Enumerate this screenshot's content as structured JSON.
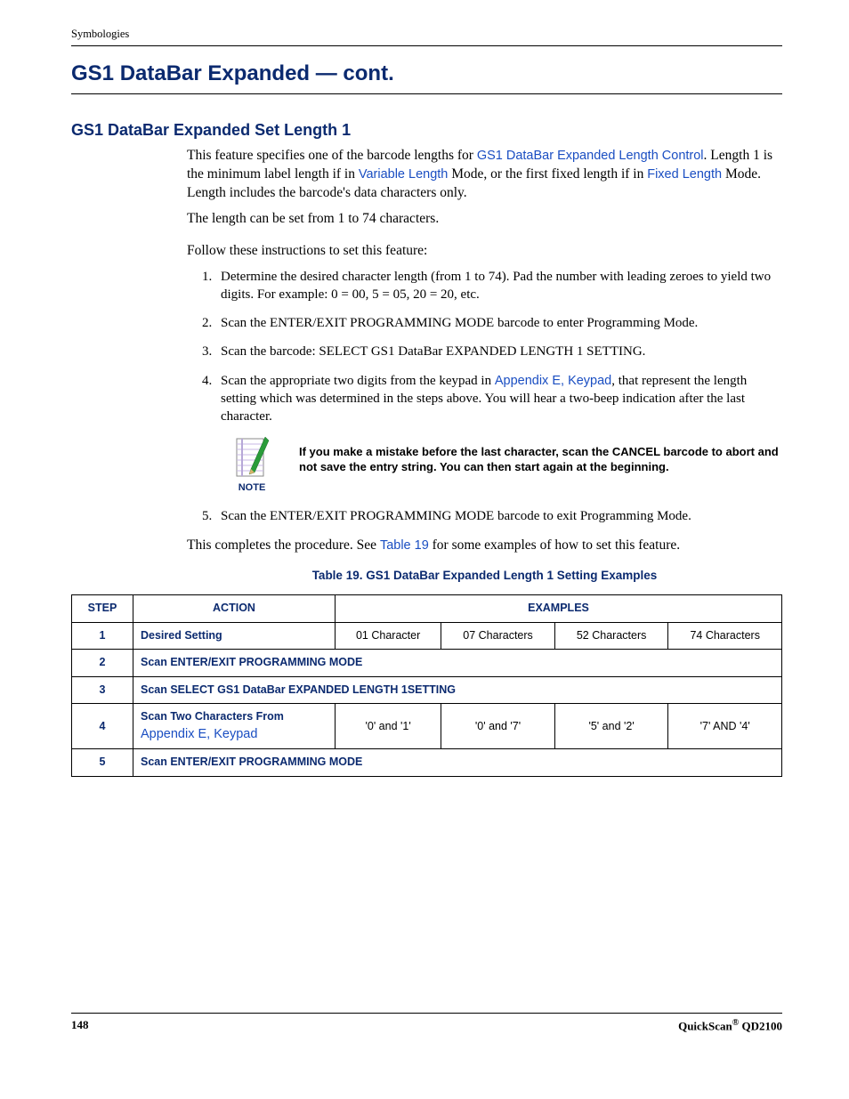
{
  "header": {
    "section": "Symbologies"
  },
  "headings": {
    "main": "GS1 DataBar Expanded — cont.",
    "sub": "GS1 DataBar Expanded Set Length 1"
  },
  "body": {
    "p1a": "This feature specifies one of the barcode lengths for ",
    "link_length_control": "GS1 DataBar Expanded Length Control",
    "p1b": ". Length 1 is the minimum label length if in ",
    "link_variable": "Variable Length",
    "p1c": " Mode, or the first fixed length if in ",
    "link_fixed": "Fixed Length",
    "p1d": " Mode. Length includes the barcode's data characters only.",
    "p2": "The length can be set from 1 to 74 characters.",
    "p3": "Follow these instructions to set this feature:"
  },
  "steps": {
    "s1": "Determine the desired character length (from 1 to 74). Pad the number with leading zeroes to yield two digits. For example: 0 = 00, 5 = 05, 20 = 20, etc.",
    "s2": "Scan the ENTER/EXIT PROGRAMMING MODE barcode to enter Programming Mode.",
    "s3": "Scan the barcode: SELECT GS1 DataBar EXPANDED LENGTH 1 SETTING.",
    "s4a": "Scan the appropriate two digits from the keypad in ",
    "s4_link": "Appendix E, Keypad",
    "s4b": ", that represent the length setting which was determined in the steps above. You will hear a two-beep indication after the last character.",
    "s5": "Scan the ENTER/EXIT PROGRAMMING MODE barcode to exit Programming Mode."
  },
  "note": {
    "label": "NOTE",
    "text": "If you make a mistake before the last character, scan the CANCEL barcode to abort and not save the entry string. You can then start again at the beginning."
  },
  "closing": {
    "a": "This completes the procedure. See ",
    "link": "Table 19",
    "b": " for some examples of how to set this feature."
  },
  "table": {
    "caption": "Table 19. GS1 DataBar Expanded Length 1 Setting Examples",
    "headers": {
      "step": "STEP",
      "action": "ACTION",
      "examples": "EXAMPLES"
    },
    "rows": {
      "r1": {
        "step": "1",
        "action": "Desired Setting",
        "c1": "01 Character",
        "c2": "07 Characters",
        "c3": "52 Characters",
        "c4": "74 Characters"
      },
      "r2": {
        "step": "2",
        "action": "Scan ENTER/EXIT PROGRAMMING MODE"
      },
      "r3": {
        "step": "3",
        "action": "Scan SELECT GS1 DataBar EXPANDED LENGTH 1SETTING"
      },
      "r4": {
        "step": "4",
        "action_a": "Scan Two Characters From ",
        "action_link": "Appendix E, Keypad",
        "c1": "'0' and '1'",
        "c2": "'0' and '7'",
        "c3": "'5' and '2'",
        "c4": "'7' AND '4'"
      },
      "r5": {
        "step": "5",
        "action": "Scan ENTER/EXIT PROGRAMMING MODE"
      }
    }
  },
  "footer": {
    "page": "148",
    "product_a": "QuickScan",
    "product_b": " QD2100"
  }
}
